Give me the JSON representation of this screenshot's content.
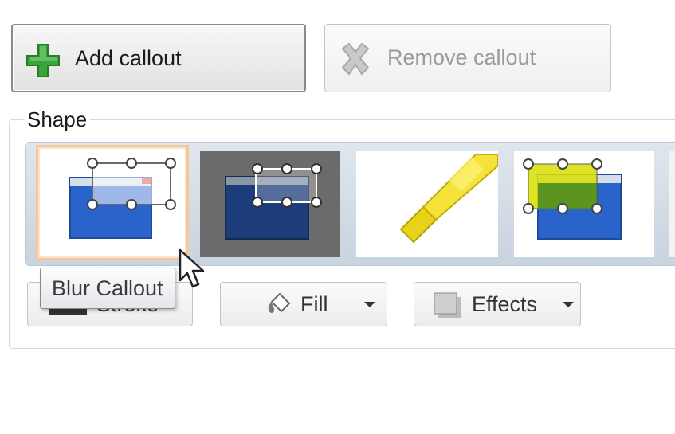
{
  "toolbar": {
    "add_label": "Add callout",
    "remove_label": "Remove callout"
  },
  "shape_group": {
    "title": "Shape",
    "gallery_items": [
      {
        "name": "Blur Callout",
        "selected": true
      },
      {
        "name": "dark callout",
        "selected": false
      },
      {
        "name": "highlighter",
        "selected": false
      },
      {
        "name": "highlight callout",
        "selected": false
      }
    ],
    "tooltip": "Blur Callout"
  },
  "format": {
    "stroke_label": "Stroke",
    "fill_label": "Fill",
    "effects_label": "Effects"
  },
  "icons": {
    "add": "plus-icon",
    "remove": "x-icon",
    "fill": "paint-bucket-icon",
    "effects": "effects-icon"
  },
  "colors": {
    "add_icon": "#3aa53a",
    "selection_border": "#f5c79a",
    "callout_blue": "#2a63c9"
  }
}
